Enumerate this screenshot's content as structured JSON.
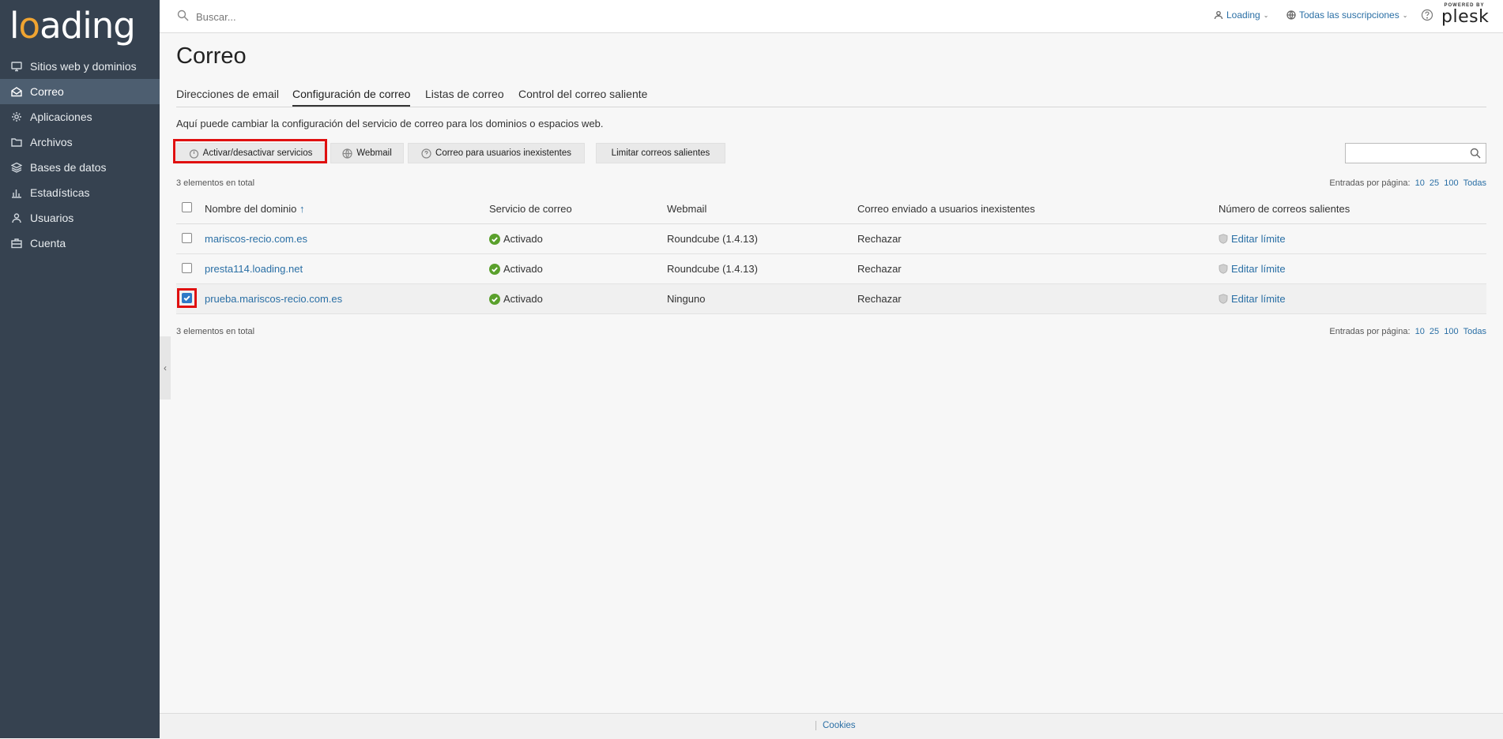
{
  "brand": {
    "logo_text_1": "l",
    "logo_o": "o",
    "logo_text_2": "ading"
  },
  "sidebar": {
    "items": [
      {
        "label": "Sitios web y dominios",
        "icon": "monitor-icon"
      },
      {
        "label": "Correo",
        "icon": "mail-icon",
        "active": true
      },
      {
        "label": "Aplicaciones",
        "icon": "gear-icon"
      },
      {
        "label": "Archivos",
        "icon": "folder-icon"
      },
      {
        "label": "Bases de datos",
        "icon": "layers-icon"
      },
      {
        "label": "Estadísticas",
        "icon": "bar-chart-icon"
      },
      {
        "label": "Usuarios",
        "icon": "user-icon"
      },
      {
        "label": "Cuenta",
        "icon": "briefcase-icon"
      }
    ]
  },
  "topbar": {
    "search_placeholder": "Buscar...",
    "user_label": "Loading",
    "subscriptions_label": "Todas las suscripciones",
    "powered_by": "POWERED BY",
    "plesk": "plesk"
  },
  "page": {
    "title": "Correo",
    "tabs": [
      {
        "label": "Direcciones de email"
      },
      {
        "label": "Configuración de correo",
        "active": true
      },
      {
        "label": "Listas de correo"
      },
      {
        "label": "Control del correo saliente"
      }
    ],
    "description": "Aquí puede cambiar la configuración del servicio de correo para los dominios o espacios web."
  },
  "toolbar": {
    "toggle_services": "Activar/desactivar servicios",
    "webmail": "Webmail",
    "nonexistent_users": "Correo para usuarios inexistentes",
    "limit_outgoing": "Limitar correos salientes"
  },
  "list": {
    "total_text": "3 elementos en total",
    "per_page_label": "Entradas por página:",
    "per_page_options": [
      "10",
      "25",
      "100",
      "Todas"
    ],
    "columns": {
      "domain": "Nombre del dominio",
      "sort_arrow": "↑",
      "mail_service": "Servicio de correo",
      "webmail": "Webmail",
      "nonexistent": "Correo enviado a usuarios inexistentes",
      "outgoing": "Número de correos salientes"
    },
    "rows": [
      {
        "domain": "mariscos-recio.com.es",
        "service": "Activado",
        "webmail": "Roundcube (1.4.13)",
        "nonexistent": "Rechazar",
        "outgoing": "Editar límite"
      },
      {
        "domain": "presta114.loading.net",
        "service": "Activado",
        "webmail": "Roundcube (1.4.13)",
        "nonexistent": "Rechazar",
        "outgoing": "Editar límite"
      },
      {
        "domain": "prueba.mariscos-recio.com.es",
        "service": "Activado",
        "webmail": "Ninguno",
        "nonexistent": "Rechazar",
        "outgoing": "Editar límite",
        "checked": true
      }
    ]
  },
  "footer": {
    "cookies": "Cookies"
  },
  "colors": {
    "sidebar": "#364250",
    "link": "#2a6fa5",
    "ok": "#5aa02c",
    "highlight": "#e01010"
  }
}
